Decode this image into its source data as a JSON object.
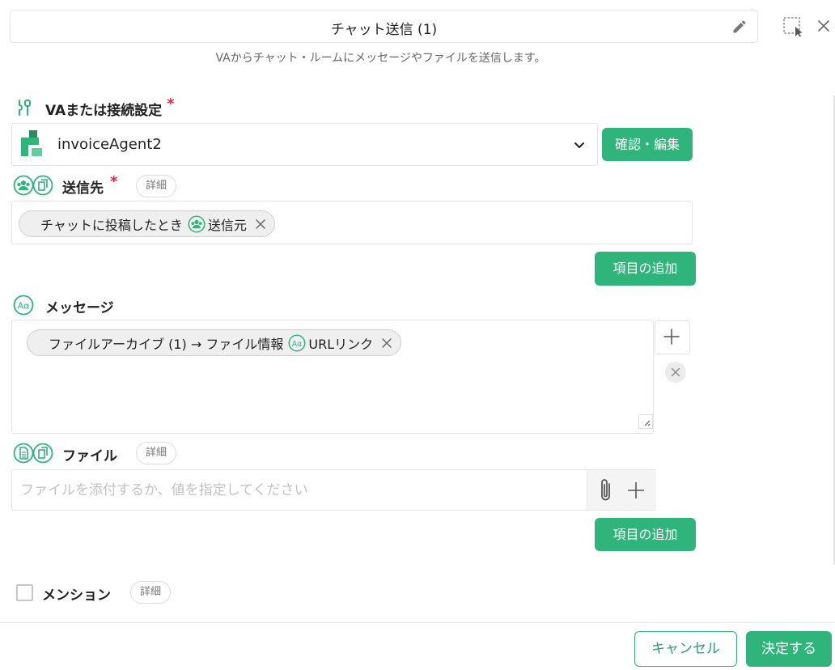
{
  "header": {
    "title": "チャット送信 (1)",
    "subtitle": "VAからチャット・ルームにメッセージやファイルを送信します。"
  },
  "va_section": {
    "label": "VAまたは接続設定",
    "required_mark": "*",
    "selected_value": "invoiceAgent2",
    "confirm_edit_button": "確認・編集"
  },
  "destination_section": {
    "label": "送信先",
    "required_mark": "*",
    "detail_label": "詳細",
    "chips": [
      {
        "prefix": "チャットに投稿したとき",
        "icon": "people-icon",
        "value": "送信元"
      }
    ],
    "add_item_button": "項目の追加"
  },
  "message_section": {
    "label": "メッセージ",
    "chips": [
      {
        "prefix": "ファイルアーカイブ (1) → ファイル情報",
        "icon": "text-aa-icon",
        "value": "URLリンク"
      }
    ]
  },
  "file_section": {
    "label": "ファイル",
    "detail_label": "詳細",
    "placeholder": "ファイルを添付するか、値を指定してください",
    "add_item_button": "項目の追加"
  },
  "mention_section": {
    "label": "メンション",
    "detail_label": "詳細",
    "checked": false
  },
  "footer": {
    "cancel_button": "キャンセル",
    "ok_button": "決定する"
  },
  "colors": {
    "accent": "#2fb47c",
    "required": "#e0263f"
  }
}
